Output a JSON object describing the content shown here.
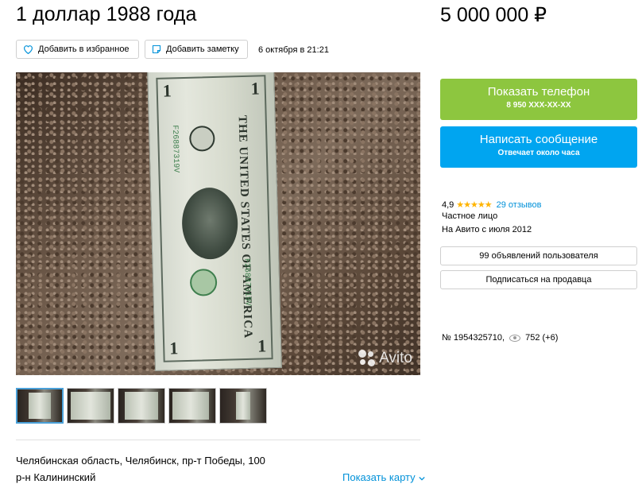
{
  "listing": {
    "title": "1 доллар 1988 года",
    "price": "5 000 000 ₽",
    "date": "6 октября в 21:21",
    "favorite_label": "Добавить в избранное",
    "note_label": "Добавить заметку"
  },
  "photo": {
    "watermark": "Avito",
    "bill_vertical_text": "THE UNITED STATES OF AMERICA",
    "serial": "F26887319V",
    "denomination": "1",
    "thumbnail_count": 5,
    "active_thumbnail": 1
  },
  "location": {
    "address": "Челябинская область, Челябинск, пр-т Победы, 100",
    "district": "р-н Калининский",
    "show_map_label": "Показать карту"
  },
  "contact": {
    "phone_button": "Показать телефон",
    "phone_masked": "8 950 XXX-XX-XX",
    "message_button": "Написать сообщение",
    "message_sub": "Отвечает около часа"
  },
  "seller": {
    "rating": "4,9",
    "stars": "★★★★★",
    "reviews": "29 отзывов",
    "type": "Частное лицо",
    "since": "На Авито с июля 2012",
    "ads_button": "99 объявлений пользователя",
    "subscribe_button": "Подписаться на продавца"
  },
  "meta": {
    "ad_number": "№ 1954325710,",
    "views": "752 (+6)"
  },
  "colors": {
    "green": "#8dc63f",
    "blue": "#00a5f0",
    "link": "#0091d9",
    "star": "#ffb400"
  }
}
